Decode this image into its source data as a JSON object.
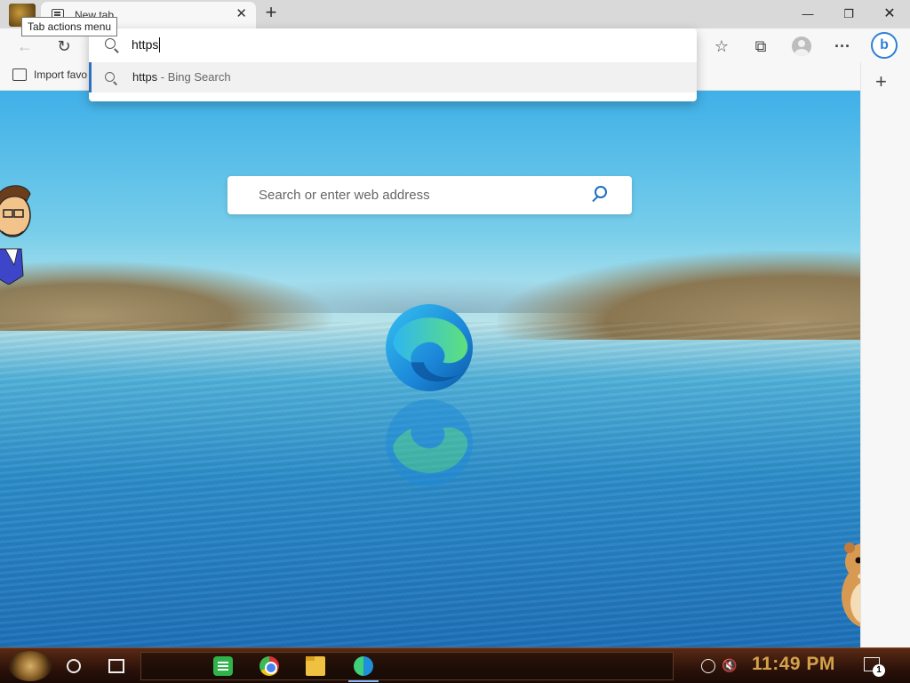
{
  "browser": {
    "tab": {
      "title": "New tab",
      "close_glyph": "✕"
    },
    "new_tab_glyph": "+",
    "tooltip": "Tab actions menu",
    "window_controls": {
      "minimize": "—",
      "maximize": "❐",
      "close": "✕"
    },
    "toolbar": {
      "back": "←",
      "refresh": "↻",
      "favorites": "☆",
      "collections": "⧉",
      "more": "···",
      "bing": "b"
    },
    "favorites_bar": {
      "import_label": "Import favo"
    },
    "omnibox": {
      "input_value": "https",
      "suggestion": {
        "query": "https",
        "source": " - Bing Search"
      }
    },
    "sidebar": {
      "add_glyph": "+"
    }
  },
  "ntp": {
    "search_placeholder": "Search or enter web address"
  },
  "taskbar": {
    "clock": "11:49 PM",
    "notification_count": "1",
    "volume_glyph": "🔇"
  },
  "colors": {
    "accent": "#2f6fc0",
    "clock": "#d4a24c",
    "taskbar": "#2b120a"
  }
}
